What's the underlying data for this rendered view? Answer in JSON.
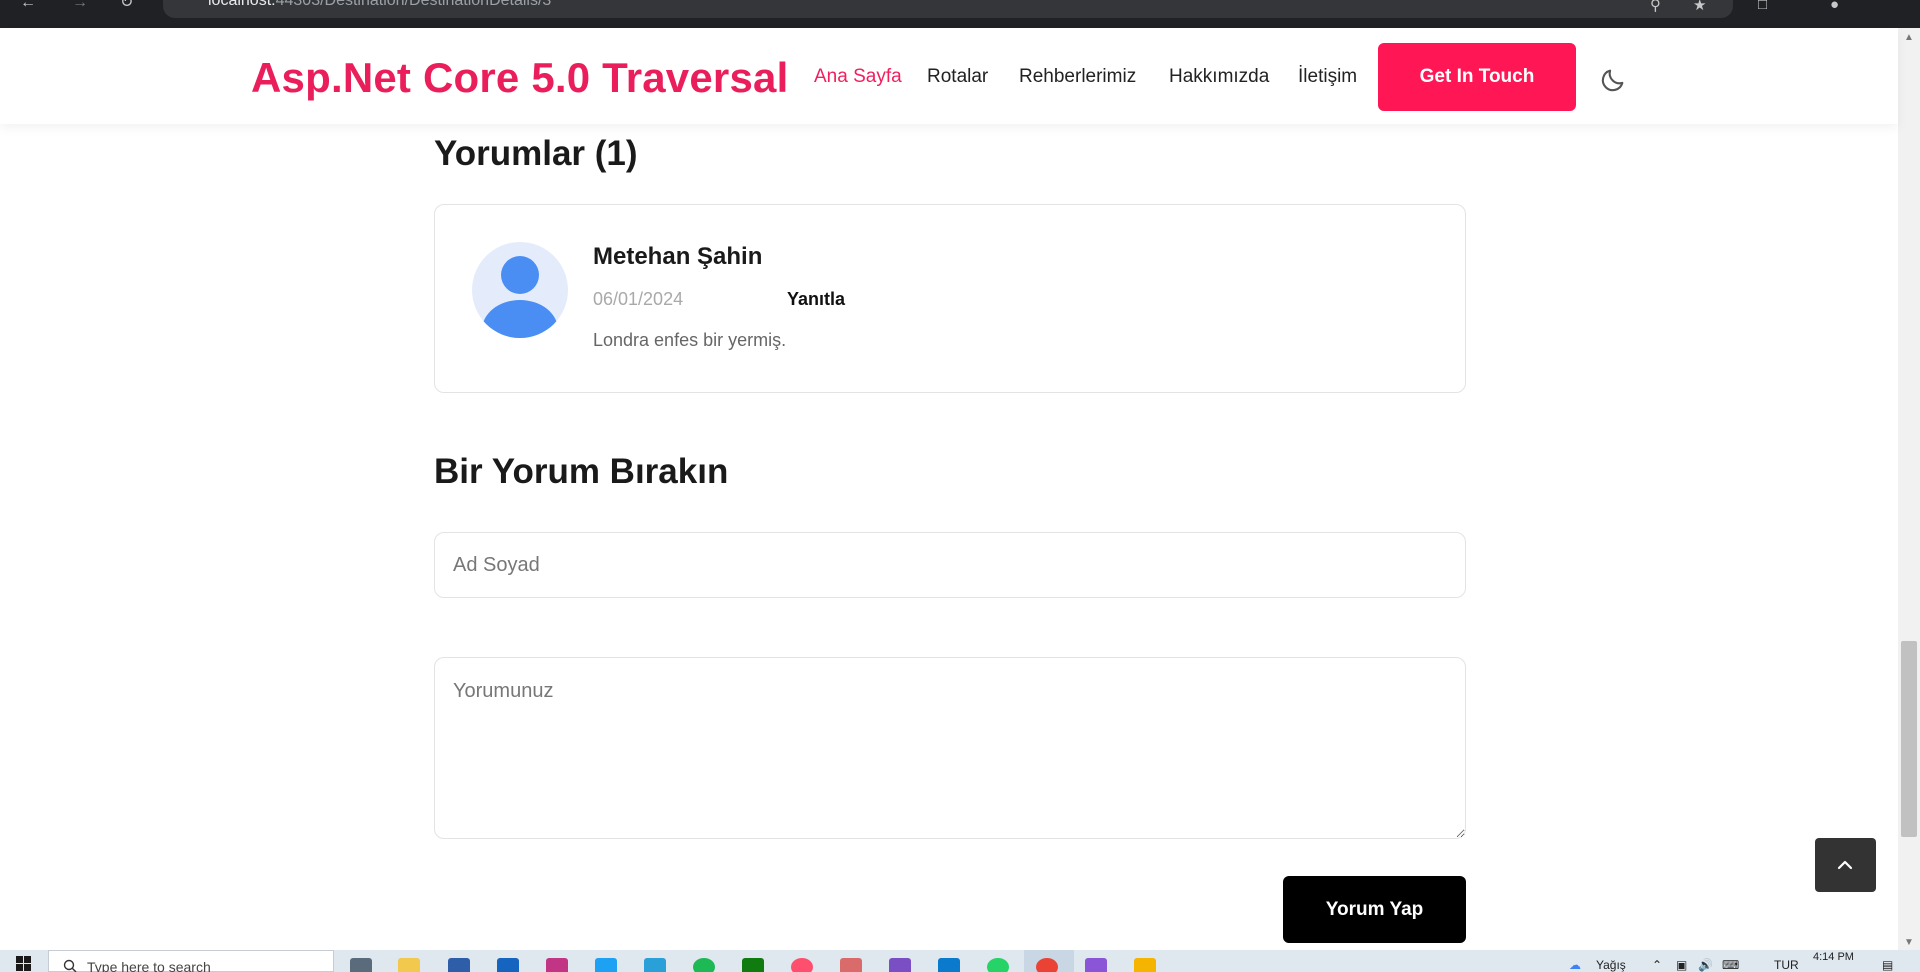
{
  "browser": {
    "address_host": "localhost:",
    "address_path": "44303/Destination/DestinationDetails/3"
  },
  "header": {
    "brand": "Asp.Net Core 5.0 Traversal",
    "nav": [
      {
        "label": "Ana Sayfa",
        "active": true
      },
      {
        "label": "Rotalar",
        "active": false
      },
      {
        "label": "Rehberlerimiz",
        "active": false
      },
      {
        "label": "Hakkımızda",
        "active": false
      },
      {
        "label": "İletişim",
        "active": false
      }
    ],
    "cta_label": "Get In Touch",
    "theme_toggle_icon": "moon-icon"
  },
  "comments": {
    "title": "Yorumlar (1)",
    "items": [
      {
        "author": "Metehan Şahin",
        "date": "06/01/2024",
        "reply_label": "Yanıtla",
        "text": "Londra enfes bir yermiş.",
        "avatar_icon": "user-avatar-icon"
      }
    ]
  },
  "form": {
    "title": "Bir Yorum Bırakın",
    "name_placeholder": "Ad Soyad",
    "comment_placeholder": "Yorumunuz",
    "submit_label": "Yorum Yap"
  },
  "back_to_top_icon": "chevron-up-icon",
  "taskbar": {
    "search_placeholder": "Type here to search",
    "weather": "Yağış",
    "language": "TUR",
    "time": "4:14 PM"
  },
  "colors": {
    "brand": "#e91e5a",
    "cta": "#ff1654",
    "avatar": "#4a8ef4"
  }
}
